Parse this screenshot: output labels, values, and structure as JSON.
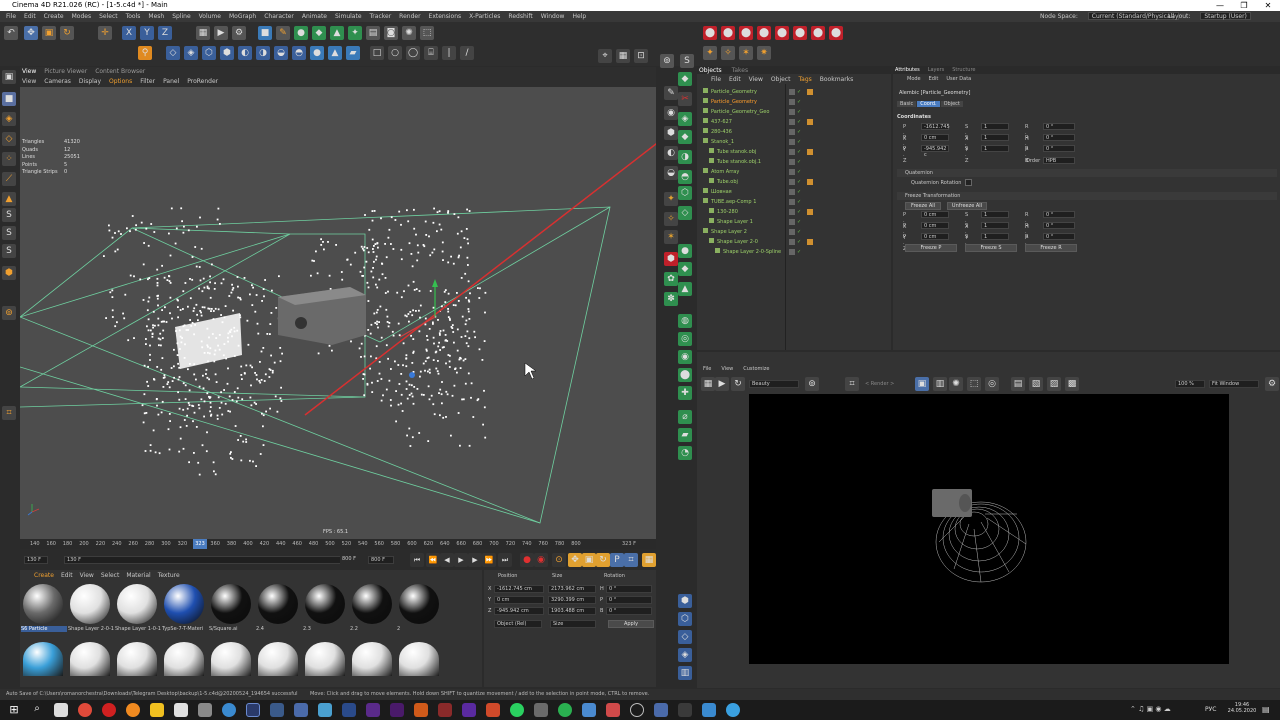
{
  "window": {
    "title": "Cinema 4D R21.026 (RC) - [1-5.c4d *] - Main",
    "controls": [
      "—",
      "❐",
      "✕"
    ]
  },
  "menu": [
    "File",
    "Edit",
    "Create",
    "Modes",
    "Select",
    "Tools",
    "Mesh",
    "Spline",
    "Volume",
    "MoGraph",
    "Character",
    "Animate",
    "Simulate",
    "Tracker",
    "Render",
    "Extensions",
    "X-Particles",
    "Redshift",
    "Window",
    "Help"
  ],
  "node_space": {
    "label": "Node Space:",
    "value": "Current (Standard/Physical)"
  },
  "layout": {
    "label": "Layout:",
    "value": "Startup (User)"
  },
  "viewport": {
    "tabs": [
      "View",
      "Picture Viewer",
      "Content Browser"
    ],
    "menu": [
      "View",
      "Cameras",
      "Display",
      "Options",
      "Filter",
      "Panel",
      "ProRender"
    ],
    "stats": [
      [
        "Triangles",
        "41320"
      ],
      [
        "Quads",
        "12"
      ],
      [
        "Lines",
        "25051"
      ],
      [
        "Points",
        "5"
      ],
      [
        "Triangle Strips",
        "0"
      ]
    ],
    "fps": "FPS : 65.1"
  },
  "timeline": {
    "ticks": [
      "140",
      "160",
      "180",
      "200",
      "220",
      "240",
      "260",
      "280",
      "300",
      "320",
      "340",
      "360",
      "380",
      "400",
      "420",
      "440",
      "460",
      "480",
      "500",
      "520",
      "540",
      "560",
      "580",
      "600",
      "620",
      "640",
      "660",
      "680",
      "700",
      "720",
      "740",
      "760",
      "780",
      "800"
    ],
    "current_frame": "323",
    "frame_display": "323 F",
    "start": "130 F",
    "start2": "130 F",
    "end": "800 F",
    "end2": "800 F"
  },
  "materials": {
    "menu": [
      "Create",
      "Edit",
      "View",
      "Select",
      "Material",
      "Texture"
    ],
    "items": [
      {
        "label": "S6 Particle",
        "color": "#6a6a6a"
      },
      {
        "label": "Shape Layer 2-0-1",
        "color": "#e0e0e0"
      },
      {
        "label": "Shape Layer 1-0-1",
        "color": "#e0e0e0"
      },
      {
        "label": "TypSe-7-T-Materi",
        "color": "#1f4fb0"
      },
      {
        "label": "S/Square.ai",
        "color": "#111111"
      },
      {
        "label": "2.4",
        "color": "#111111"
      },
      {
        "label": "2.3",
        "color": "#111111"
      },
      {
        "label": "2.2",
        "color": "#111111"
      },
      {
        "label": "2",
        "color": "#111111"
      }
    ],
    "row2": [
      "#3a9fd8",
      "#e0e0e0",
      "#e0e0e0",
      "#e0e0e0",
      "#e0e0e0",
      "#e0e0e0",
      "#e0e0e0",
      "#e0e0e0",
      "#e0e0e0"
    ]
  },
  "coords": {
    "headers": [
      "Position",
      "Size",
      "Rotation"
    ],
    "rows": [
      {
        "axis": "X",
        "pos": "-1612.745 cm",
        "size": "2173.962 cm",
        "rl": "H",
        "rot": "0 °"
      },
      {
        "axis": "Y",
        "pos": "0 cm",
        "size": "3290.399 cm",
        "rl": "P",
        "rot": "0 °"
      },
      {
        "axis": "Z",
        "pos": "-945.942 cm",
        "size": "1903.488 cm",
        "rl": "B",
        "rot": "0 °"
      }
    ],
    "mode": "Object (Rel)",
    "size_mode": "Size",
    "apply": "Apply"
  },
  "objects": {
    "tabs": [
      "Objects",
      "Takes"
    ],
    "menu": [
      "File",
      "Edit",
      "View",
      "Object",
      "Tags",
      "Bookmarks"
    ],
    "rows": [
      {
        "name": "Particle_Geometry",
        "indent": 0,
        "sel": false
      },
      {
        "name": "Particle_Geometry",
        "indent": 0,
        "sel": true
      },
      {
        "name": "Particle_Geometry_Geo",
        "indent": 0,
        "sel": false
      },
      {
        "name": "437-627",
        "indent": 0,
        "sel": false
      },
      {
        "name": "280-436",
        "indent": 0,
        "sel": false
      },
      {
        "name": "Stanok_1",
        "indent": 0,
        "sel": false
      },
      {
        "name": "Tube stanok.obj",
        "indent": 1,
        "sel": false
      },
      {
        "name": "Tube stanok.obj.1",
        "indent": 1,
        "sel": false
      },
      {
        "name": "Atom Array",
        "indent": 0,
        "sel": false
      },
      {
        "name": "Tube.obj",
        "indent": 1,
        "sel": false
      },
      {
        "name": "Шовная",
        "indent": 0,
        "sel": false
      },
      {
        "name": "TUBE.aep-Comp 1",
        "indent": 0,
        "sel": false
      },
      {
        "name": "130-280",
        "indent": 1,
        "sel": false
      },
      {
        "name": "Shape Layer 1",
        "indent": 1,
        "sel": false
      },
      {
        "name": "Shape Layer 2",
        "indent": 0,
        "sel": false
      },
      {
        "name": "Shape Layer 2-0",
        "indent": 1,
        "sel": false
      },
      {
        "name": "Shape Layer 2-0-Spline",
        "indent": 2,
        "sel": false
      }
    ]
  },
  "attributes": {
    "tabs": [
      "Attributes",
      "Layers",
      "Structure"
    ],
    "menu": [
      "Mode",
      "Edit",
      "User Data"
    ],
    "object_title": "Alembic [Particle_Geometry]",
    "subtabs": [
      "Basic",
      "Coord.",
      "Object"
    ],
    "section": "Coordinates",
    "coords": [
      {
        "p": "P . X",
        "pv": "-1612.745",
        "s": "S . X",
        "sv": "1",
        "r": "R . H",
        "rv": "0 °"
      },
      {
        "p": "P . Y",
        "pv": "0 cm",
        "s": "S . Y",
        "sv": "1",
        "r": "R . P",
        "rv": "0 °"
      },
      {
        "p": "P . Z",
        "pv": "-945.942 c",
        "s": "S . Z",
        "sv": "1",
        "r": "R . B",
        "rv": "0 °"
      }
    ],
    "order_label": "Order",
    "order_value": "HPB",
    "quaternion": "Quaternion",
    "quaternion_rotation": "Quaternion Rotation",
    "freeze": "Freeze Transformation",
    "freeze_all": "Freeze All",
    "unfreeze_all": "Unfreeze All",
    "fcoords": [
      {
        "p": "P . X",
        "pv": "0 cm",
        "s": "S . X",
        "sv": "1",
        "r": "R . H",
        "rv": "0 °"
      },
      {
        "p": "P . Y",
        "pv": "0 cm",
        "s": "S . Y",
        "sv": "1",
        "r": "R . P",
        "rv": "0 °"
      },
      {
        "p": "P . Z",
        "pv": "0 cm",
        "s": "S . Z",
        "sv": "1",
        "r": "R . B",
        "rv": "0 °"
      }
    ],
    "freeze_p": "Freeze P",
    "freeze_s": "Freeze S",
    "freeze_r": "Freeze R"
  },
  "picture_viewer": {
    "menu": [
      "File",
      "View",
      "Customize"
    ],
    "pass": "Beauty",
    "render_slot": "< Render >",
    "zoom": "100 %",
    "fit": "Fit Window"
  },
  "status": "Auto Save of C:\\Users\\romanorchestra\\Downloads\\Telegram Desktop\\backup\\1-5.c4d@20200524_194654 successful",
  "status2": "Move: Click and drag to move elements. Hold down SHIFT to quantize movement / add to the selection in point mode, CTRL to remove.",
  "taskbar": {
    "lang": "РУС",
    "time": "19:46",
    "date": "24.05.2020"
  }
}
